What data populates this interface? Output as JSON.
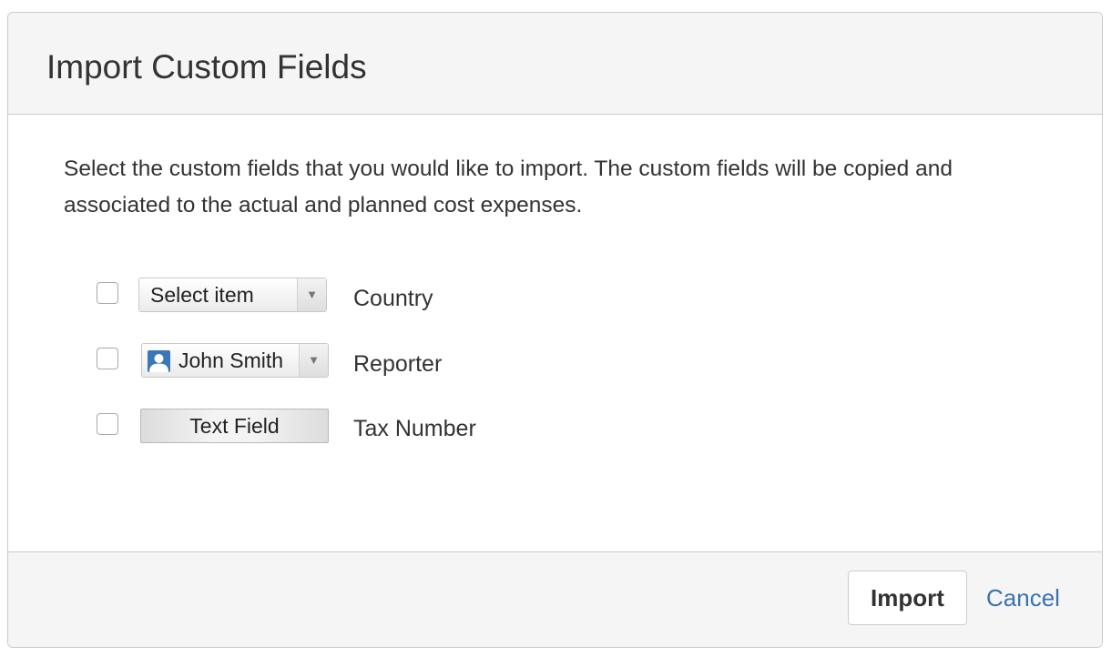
{
  "dialog": {
    "title": "Import Custom Fields",
    "description": "Select the custom fields that you would like to import. The custom fields will be copied and associated to the actual and planned cost expenses."
  },
  "fields": [
    {
      "control": "select",
      "control_text": "Select item",
      "label": "Country",
      "checked": false
    },
    {
      "control": "user-picker",
      "control_text": "John Smith",
      "label": "Reporter",
      "checked": false
    },
    {
      "control": "text-field",
      "control_text": "Text Field",
      "label": "Tax Number",
      "checked": false
    }
  ],
  "footer": {
    "import_label": "Import",
    "cancel_label": "Cancel"
  },
  "icons": {
    "dropdown_arrow": "▼",
    "avatar": "user-avatar-icon"
  },
  "colors": {
    "link": "#3b73af",
    "avatar": "#3a77b8",
    "header_bg": "#f5f5f5"
  }
}
